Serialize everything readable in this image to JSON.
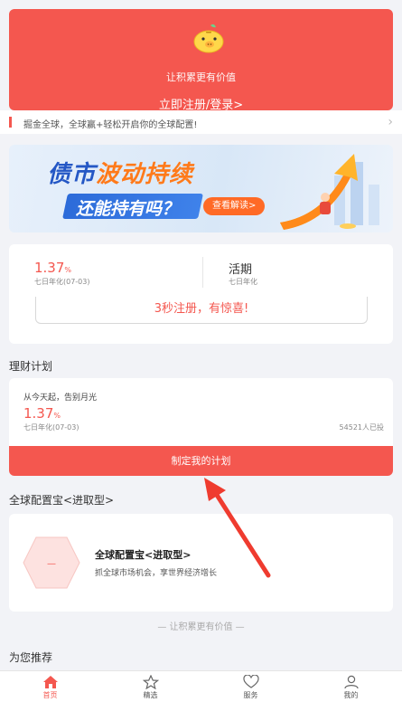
{
  "colors": {
    "accent": "#f4574f",
    "banner_orange": "#ff7a1a",
    "banner_blue": "#2457c5",
    "page_bg": "#f2f3f7"
  },
  "header": {
    "tagline": "让积累更有价值",
    "cta": "立即注册/登录>"
  },
  "notice": {
    "text": "掘金全球，全球赢+轻松开启你的全球配置!",
    "chevron": "›"
  },
  "banner": {
    "line1_a": "债市",
    "line1_b": "波动持续",
    "line2": "还能持有吗？",
    "button": "查看解读>"
  },
  "product_card": {
    "rate_value": "1.37",
    "rate_unit": "%",
    "rate_label": "七日年化(07-03)",
    "current_title": "活期",
    "current_label": "七日年化",
    "register_prompt": "3秒注册，有惊喜!"
  },
  "plan_section": {
    "title": "理财计划",
    "subtitle": "从今天起，告别月光",
    "rate_value": "1.37",
    "rate_unit": "%",
    "rate_label": "七日年化(07-03)",
    "count": "54521人已投",
    "button": "制定我的计划"
  },
  "global_section": {
    "title": "全球配置宝<进取型>",
    "card_title": "全球配置宝<进取型>",
    "card_desc": "抓全球市场机会，享世界经济增长",
    "hex_text": "—"
  },
  "slogan": "— 让积累更有价值 —",
  "recommend_title": "为您推荐",
  "tabbar": {
    "tabs": [
      {
        "label": "首页",
        "icon": "home-icon",
        "active": true
      },
      {
        "label": "精选",
        "icon": "star-icon",
        "active": false
      },
      {
        "label": "服务",
        "icon": "heart-icon",
        "active": false
      },
      {
        "label": "我的",
        "icon": "user-icon",
        "active": false
      }
    ]
  }
}
